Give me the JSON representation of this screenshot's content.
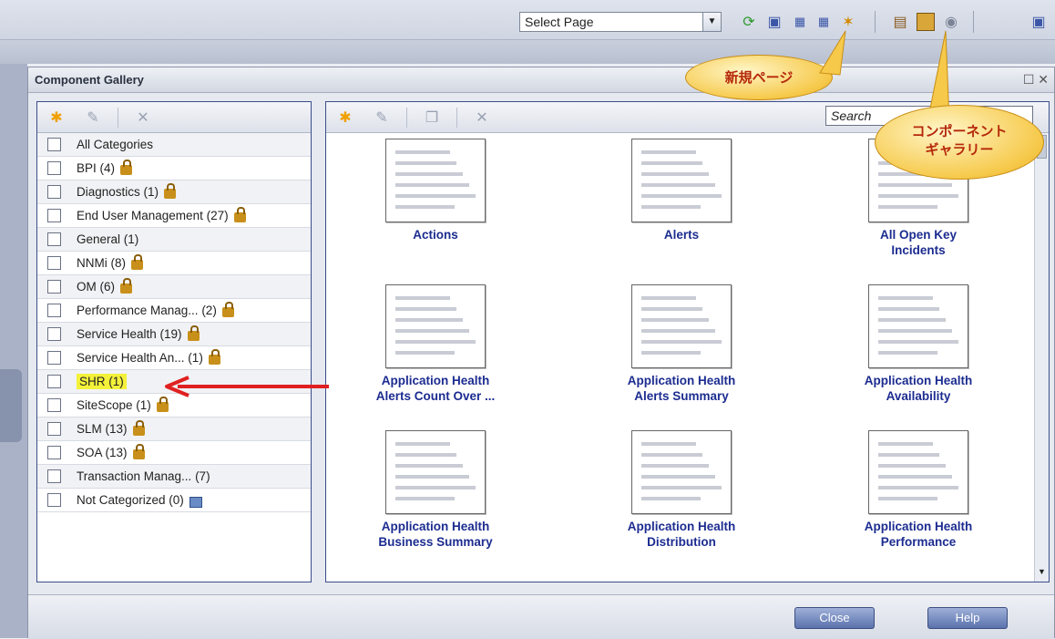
{
  "toolbar": {
    "select_page_value": "Select Page",
    "icons": [
      "refresh-icon",
      "save-icon",
      "layout-icon",
      "new-page-icon",
      "properties-icon",
      "component-gallery-icon",
      "target-icon",
      "monitor-icon"
    ]
  },
  "dialog": {
    "title": "Component Gallery"
  },
  "categories": [
    {
      "label": "All Categories",
      "lock": false
    },
    {
      "label": "BPI (4)",
      "lock": true
    },
    {
      "label": "Diagnostics (1)",
      "lock": true
    },
    {
      "label": "End User Management (27)",
      "lock": true
    },
    {
      "label": "General (1)",
      "lock": false
    },
    {
      "label": "NNMi (8)",
      "lock": true
    },
    {
      "label": "OM (6)",
      "lock": true
    },
    {
      "label": "Performance Manag... (2)",
      "lock": true
    },
    {
      "label": "Service Health (19)",
      "lock": true
    },
    {
      "label": "Service Health An... (1)",
      "lock": true
    },
    {
      "label": "SHR (1)",
      "lock": false,
      "highlight": true
    },
    {
      "label": "SiteScope (1)",
      "lock": true
    },
    {
      "label": "SLM (13)",
      "lock": true
    },
    {
      "label": "SOA (13)",
      "lock": true
    },
    {
      "label": "Transaction Manag... (7)",
      "lock": false
    },
    {
      "label": "Not Categorized (0)",
      "lock": false,
      "image_icon": true
    }
  ],
  "search": {
    "placeholder": "Search"
  },
  "gallery": [
    {
      "line1": "Actions",
      "line2": ""
    },
    {
      "line1": "Alerts",
      "line2": ""
    },
    {
      "line1": "All Open Key",
      "line2": "Incidents"
    },
    {
      "line1": "Application Health",
      "line2": "Alerts Count Over ..."
    },
    {
      "line1": "Application Health",
      "line2": "Alerts Summary"
    },
    {
      "line1": "Application Health",
      "line2": "Availability"
    },
    {
      "line1": "Application Health",
      "line2": "Business Summary"
    },
    {
      "line1": "Application Health",
      "line2": "Distribution"
    },
    {
      "line1": "Application Health",
      "line2": "Performance"
    }
  ],
  "buttons": {
    "close": "Close",
    "help": "Help"
  },
  "callouts": {
    "new_page": "新規ページ",
    "gallery_line1": "コンポーネント",
    "gallery_line2": "ギャラリー"
  },
  "colors": {
    "accent_text": "#1c2c90",
    "highlight": "#f4f13a",
    "arrow": "#e02020",
    "callout_text": "#b5280a"
  }
}
